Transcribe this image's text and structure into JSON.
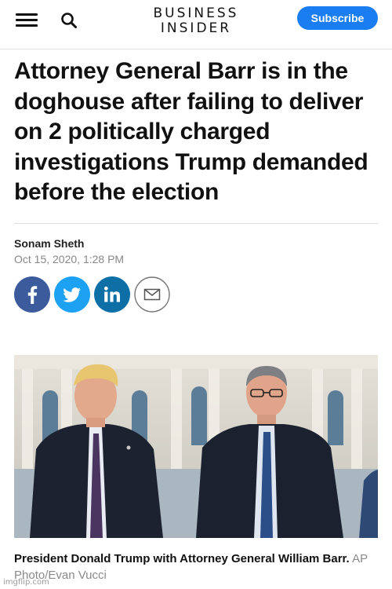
{
  "header": {
    "logo_line1": "BUSINESS",
    "logo_line2": "INSIDER",
    "subscribe_label": "Subscribe",
    "menu_icon": "hamburger-menu-icon",
    "search_icon": "search-icon",
    "accent_color": "#1a7ef2"
  },
  "article": {
    "headline": "Attorney General Barr is in the doghouse after failing to deliver on 2 politically charged investigations Trump demanded before the election",
    "author": "Sonam Sheth",
    "date": "Oct 15, 2020, 1:28 PM"
  },
  "share": {
    "buttons": [
      {
        "icon": "facebook-icon",
        "color": "#3b5b9c"
      },
      {
        "icon": "twitter-icon",
        "color": "#1da1f2"
      },
      {
        "icon": "linkedin-icon",
        "color": "#0e6fa6"
      },
      {
        "icon": "email-icon",
        "color": "#ffffff"
      }
    ]
  },
  "photo": {
    "caption": "President Donald Trump with Attorney General William Barr.",
    "credit": "AP Photo/Evan Vucci"
  },
  "watermark": "imgflip.com"
}
